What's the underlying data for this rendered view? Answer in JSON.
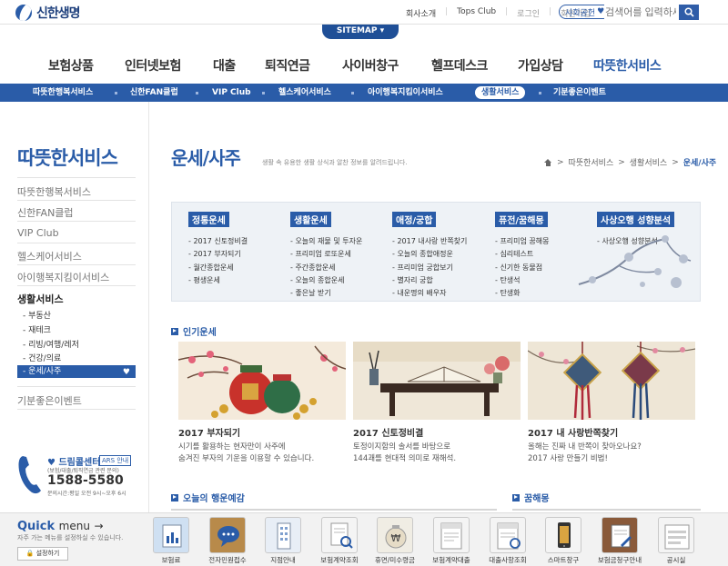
{
  "header": {
    "logo": "신한생명",
    "links": [
      "회사소개",
      "Tops Club",
      "로그인",
      "회원가입"
    ],
    "social": "사회공헌",
    "search_placeholder": "검색어를 입력하세",
    "sitemap": "SITEMAP"
  },
  "gnb": [
    "보험상품",
    "인터넷보험",
    "대출",
    "퇴직연금",
    "사이버창구",
    "헬프데스크",
    "가입상담",
    "따뜻한서비스"
  ],
  "subnav": [
    "따뜻한행복서비스",
    "신한FAN클럽",
    "VIP Club",
    "헬스케어서비스",
    "아이행복지킴이서비스",
    "생활서비스",
    "기분좋은이벤트"
  ],
  "lnb": {
    "title": "따뜻한서비스",
    "items": [
      "따뜻한행복서비스",
      "신한FAN클럽",
      "VIP Club",
      "헬스케어서비스",
      "아이행복지킴이서비스",
      "생활서비스"
    ],
    "subitems": [
      "부동산",
      "재테크",
      "리빙/여행/레저",
      "건강/의료",
      "운세/사주"
    ],
    "last": "기분좋은이벤트"
  },
  "page": {
    "title": "운세/사주",
    "desc": "생활 속 유용한 생활 상식과 알찬 정보를 알려드립니다.",
    "breadcrumb": [
      "따뜻한서비스",
      "생활서비스",
      "운세/사주"
    ]
  },
  "categories": [
    {
      "head": "정통운세",
      "items": [
        "2017 신토정비결",
        "2017 부자되기",
        "월간종합운세",
        "평생운세"
      ]
    },
    {
      "head": "생활운세",
      "items": [
        "오늘의 재물 및 투자운",
        "프리미엄 로또운세",
        "주간종합운세",
        "오늘의 종합운세",
        "좋은날 받기"
      ]
    },
    {
      "head": "애정/궁합",
      "items": [
        "2017 내사랑 반쪽찾기",
        "오늘의 종합애정운",
        "프리미엄 궁합보기",
        "별자리 궁합",
        "내운명의 배우자"
      ]
    },
    {
      "head": "퓨전/꿈해몽",
      "items": [
        "프리미엄 꿈해몽",
        "심리테스트",
        "신기한 동물점",
        "탄생석",
        "탄생화"
      ]
    },
    {
      "head": "사상오행 성향분석",
      "items": [
        "사상오행 성향분석"
      ]
    }
  ],
  "sections": {
    "popular": "인기운세",
    "today": "오늘의 행운예감",
    "dream": "꿈해몽"
  },
  "cards": [
    {
      "title": "2017 부자되기",
      "desc1": "시기를 활용하는 현자만이 사주에",
      "desc2": "숨겨진 부자의 기운을 이용할 수 있습니다."
    },
    {
      "title": "2017 신토정비결",
      "desc1": "토정이지함의 솔서를 바탕으로",
      "desc2": "144괘를 현대적 의미로 재해석."
    },
    {
      "title": "2017 내 사랑반쪽찾기",
      "desc1": "올해는 진짜 내 반쪽이 찾아오나요?",
      "desc2": "2017 사랑 만들기 비법!"
    }
  ],
  "callcenter": {
    "title": "드림콜센터",
    "tag": "ARS 안내",
    "sub": "(보험/대출/퇴직연금 관련 문의)",
    "number": "1588-5580",
    "hours": "문의시간:평일 오전 9시~오후 6시"
  },
  "quickmenu": {
    "title": "Quick",
    "title2": "menu",
    "desc": "자주 가는 메뉴를 설정하실 수 있습니다.",
    "setting": "설정하기",
    "items": [
      "보험료",
      "전자민원접수",
      "지점안내",
      "보험계약조회",
      "휴면/미수령금",
      "보험계약대출",
      "대출사항조회",
      "스마트창구",
      "보험금청구안내",
      "공시실"
    ]
  },
  "colors": {
    "brand": "#2a5ca8",
    "navy": "#1f4f97"
  }
}
